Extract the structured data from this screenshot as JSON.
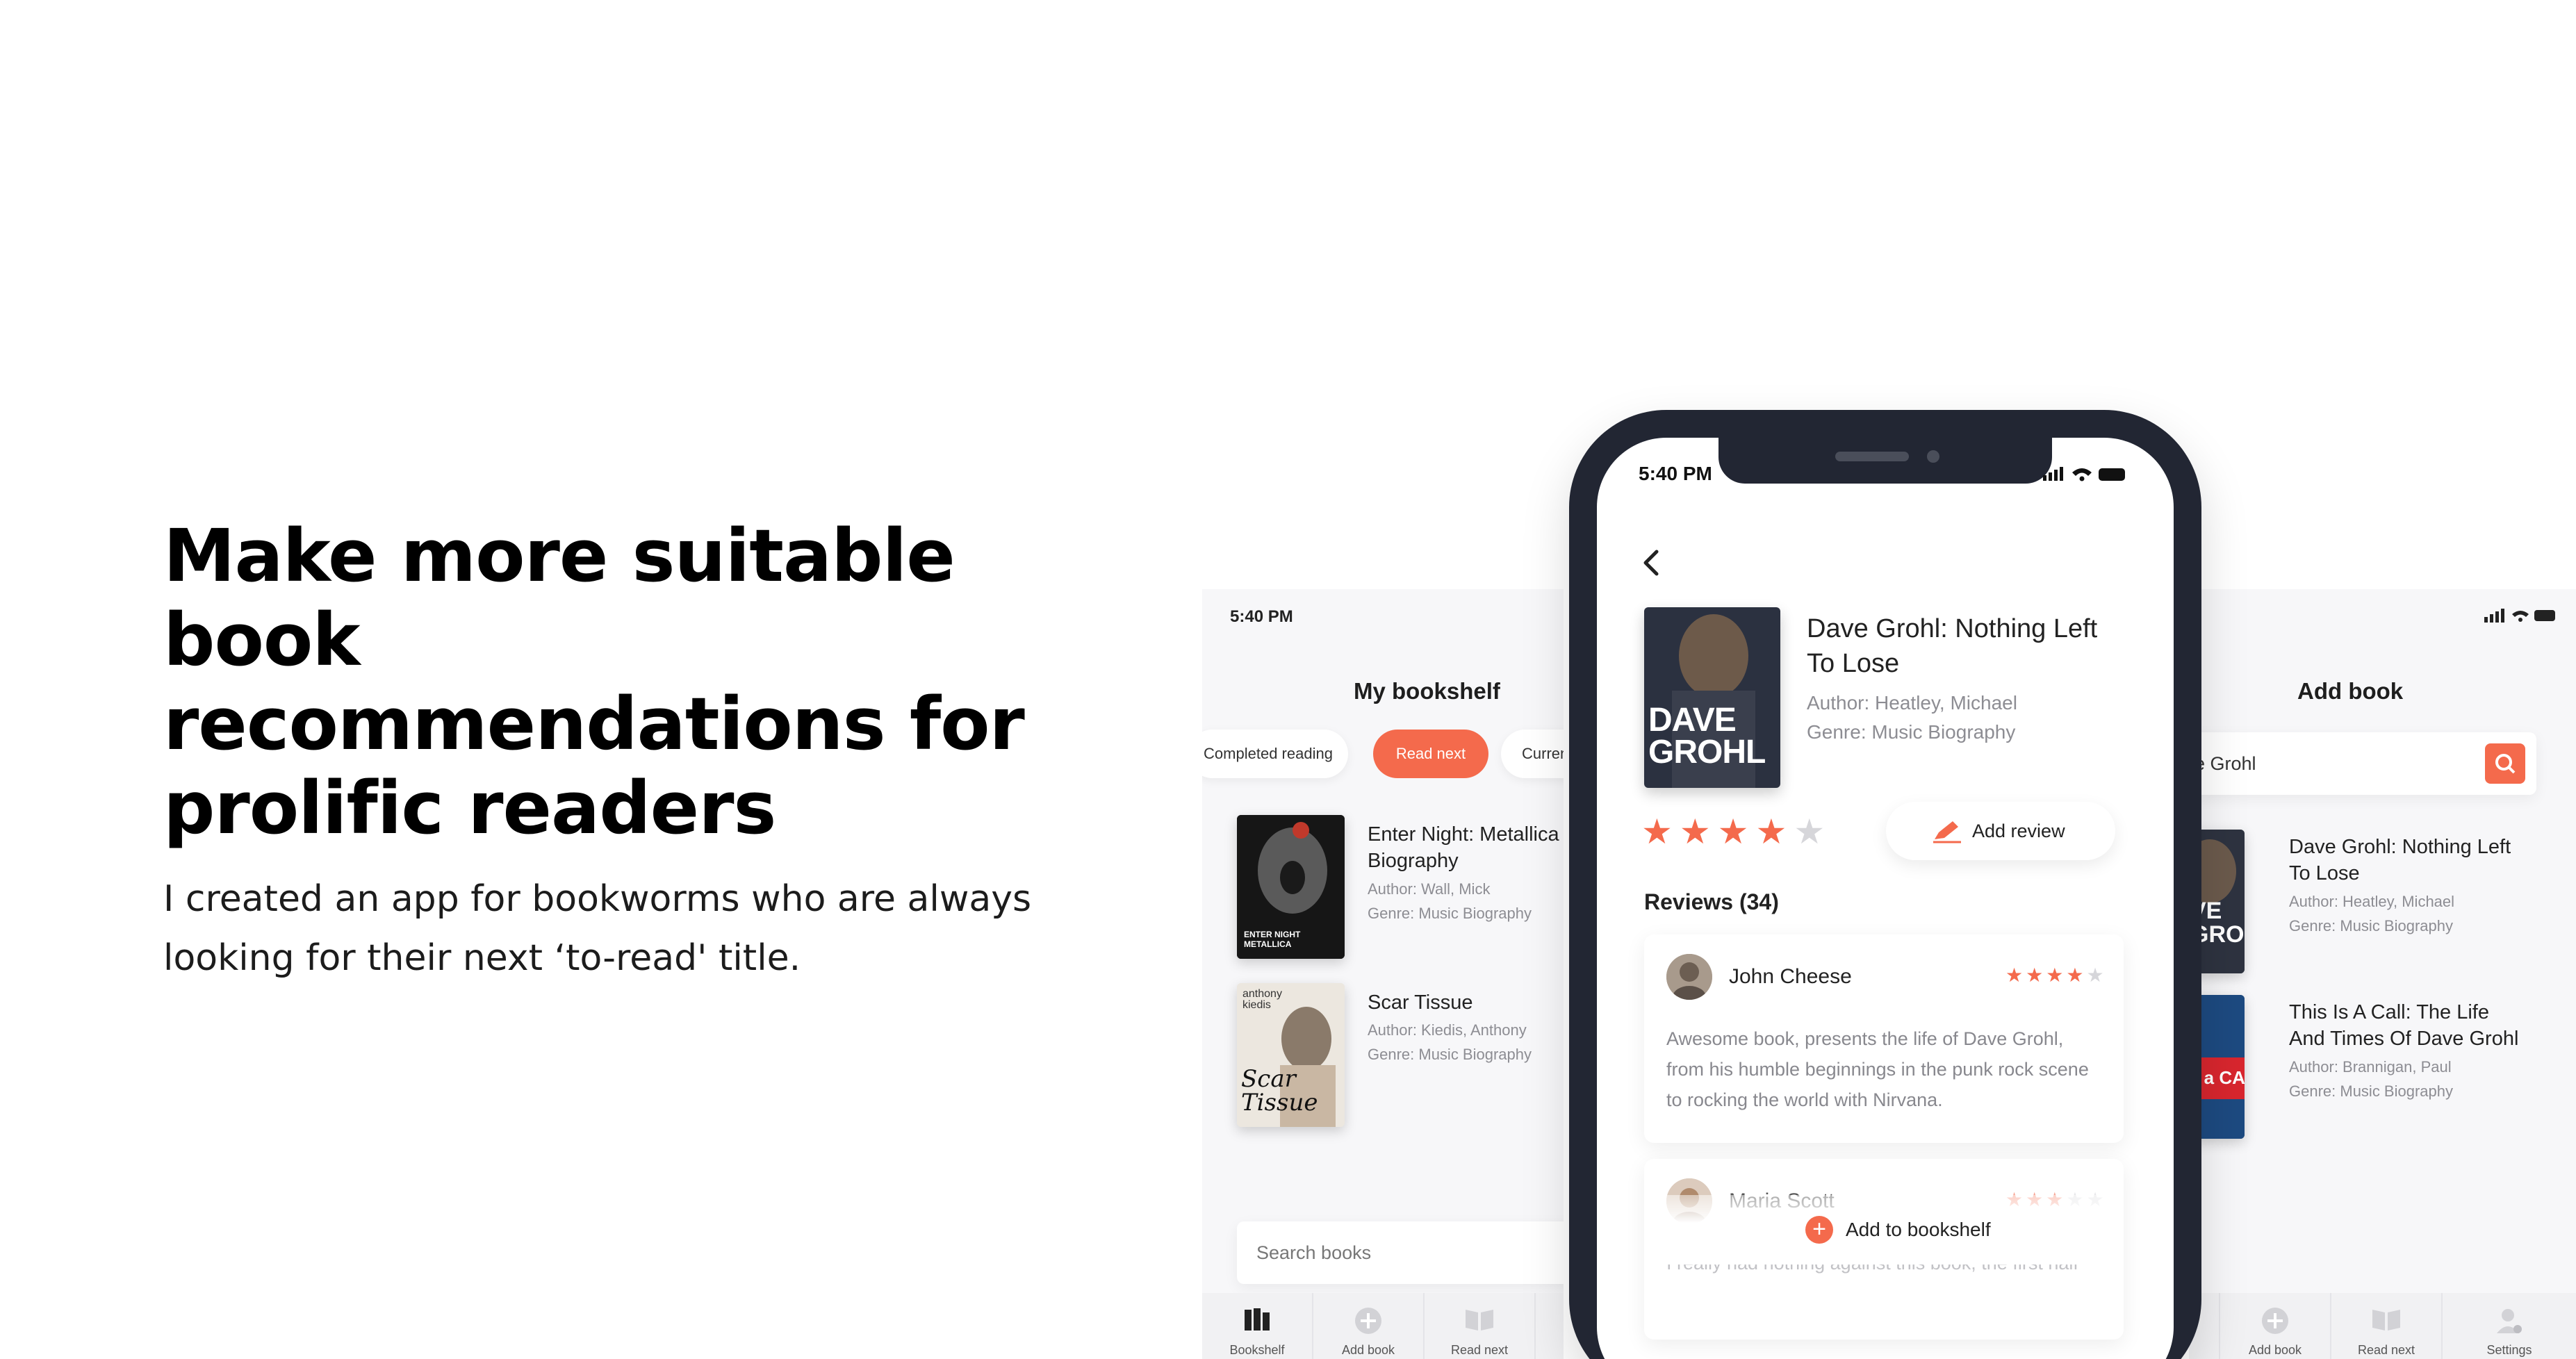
{
  "hero": {
    "title_lines": [
      "Make more suitable book",
      "recommendations for",
      "prolific readers"
    ],
    "subtitle_lines": [
      "I created an app for bookworms who are always",
      "looking for their next ‘to-read' title."
    ]
  },
  "left_screen": {
    "status_time": "5:40 PM",
    "title": "My bookshelf",
    "tabs": [
      {
        "label": "Completed reading",
        "active": false
      },
      {
        "label": "Read next",
        "active": true
      },
      {
        "label": "Curren",
        "active": false
      }
    ],
    "books": [
      {
        "title_lines": [
          "Enter Night: Metallica",
          "Biography"
        ],
        "author": "Author: Wall, Mick",
        "genre": "Genre: Music Biography",
        "cover_text": "ENTER NIGHT METALLICA"
      },
      {
        "title_lines": [
          "Scar Tissue"
        ],
        "author": "Author: Kiedis, Anthony",
        "genre": "Genre: Music Biography",
        "cover_text_top": "anthony kiedis",
        "cover_text_bottom": "Scar Tissue"
      }
    ],
    "search_placeholder": "Search books",
    "nav": [
      "Bookshelf",
      "Add book",
      "Read next"
    ]
  },
  "center_screen": {
    "status_time": "5:40 PM",
    "book": {
      "title_lines": [
        "Dave Grohl: Nothing Left",
        "To Lose"
      ],
      "author": "Author: Heatley, Michael",
      "genre": "Genre: Music Biography",
      "cover_text": "DAVE GROHL",
      "rating": 4
    },
    "add_review_label": "Add review",
    "reviews_heading": "Reviews (34)",
    "reviews": [
      {
        "name": "John Cheese",
        "rating": 4,
        "text_lines": [
          "Awesome book, presents the life of Dave Grohl,",
          "from his humble beginnings in the punk rock scene",
          "to rocking the world with Nirvana."
        ]
      },
      {
        "name": "Maria Scott",
        "rating": 3,
        "text_lines": [
          "I really had nothing against this book, the first half"
        ]
      }
    ],
    "add_to_bookshelf_label": "Add to bookshelf",
    "accent_color": "#f46a4c"
  },
  "right_screen": {
    "title": "Add book",
    "search_value": "e Grohl",
    "books": [
      {
        "title_lines": [
          "Dave Grohl: Nothing Left",
          "To Lose"
        ],
        "author": "Author: Heatley, Michael",
        "genre": "Genre: Music Biography",
        "cover_text": "VE GRO"
      },
      {
        "title_lines": [
          "This Is A Call: The Life",
          "And Times Of Dave Grohl"
        ],
        "author": "Author: Brannigan, Paul",
        "genre": "Genre: Music Biography",
        "cover_text": "s a CALL"
      }
    ],
    "nav": [
      "Add book",
      "Read next",
      "Settings"
    ]
  }
}
